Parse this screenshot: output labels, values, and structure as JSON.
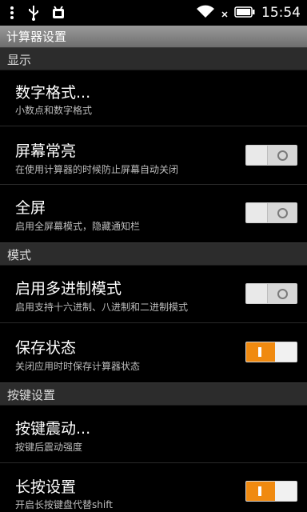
{
  "status_bar": {
    "time": "15:54"
  },
  "title": "计算器设置",
  "sections": [
    {
      "label": "显示"
    },
    {
      "label": "模式"
    },
    {
      "label": "按键设置"
    }
  ],
  "rows": {
    "number_format": {
      "title": "数字格式...",
      "subtitle": "小数点和数字格式"
    },
    "screen_on": {
      "title": "屏幕常亮",
      "subtitle": "在使用计算器的时候防止屏幕自动关闭",
      "toggle": "off"
    },
    "fullscreen": {
      "title": "全屏",
      "subtitle": "启用全屏幕模式，隐藏通知栏",
      "toggle": "off"
    },
    "multi_base": {
      "title": "启用多进制模式",
      "subtitle": "启用支持十六进制、八进制和二进制模式",
      "toggle": "off"
    },
    "save_state": {
      "title": "保存状态",
      "subtitle": "关闭应用时时保存计算器状态",
      "toggle": "on"
    },
    "key_vibration": {
      "title": "按键震动...",
      "subtitle": "按键后震动强度"
    },
    "long_press": {
      "title": "长按设置",
      "subtitle": "开启长按键盘代替shift",
      "toggle": "on"
    }
  },
  "colors": {
    "accent": "#f08a10",
    "background": "#000000"
  }
}
